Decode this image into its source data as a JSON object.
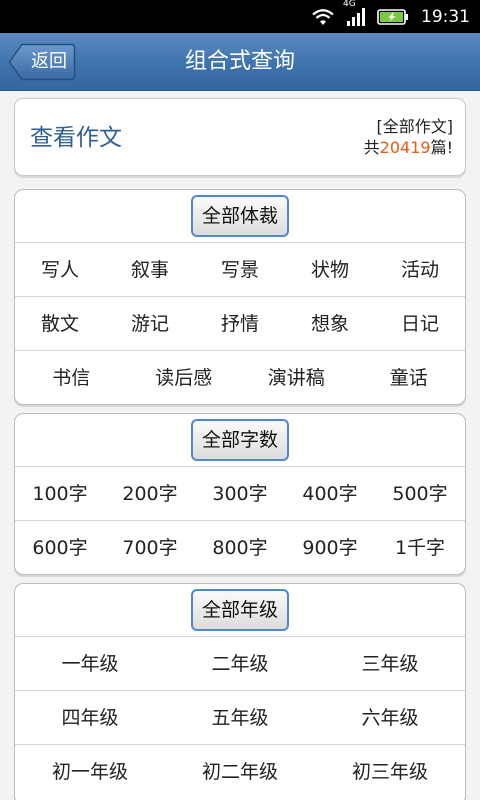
{
  "status_bar": {
    "network": "4G",
    "time": "19:31",
    "icons": [
      "wifi-icon",
      "signal-icon",
      "battery-charging-icon"
    ]
  },
  "header": {
    "back_label": "返回",
    "title": "组合式查询"
  },
  "view_card": {
    "title": "查看作文",
    "filter_label": "[全部作文]",
    "count_prefix": "共",
    "count": "20419",
    "count_suffix": "篇!"
  },
  "genre": {
    "header": "全部体裁",
    "rows": [
      [
        "写人",
        "叙事",
        "写景",
        "状物",
        "活动"
      ],
      [
        "散文",
        "游记",
        "抒情",
        "想象",
        "日记"
      ],
      [
        "书信",
        "读后感",
        "演讲稿",
        "童话"
      ]
    ]
  },
  "wordcount": {
    "header": "全部字数",
    "rows": [
      [
        "100字",
        "200字",
        "300字",
        "400字",
        "500字"
      ],
      [
        "600字",
        "700字",
        "800字",
        "900字",
        "1千字"
      ]
    ]
  },
  "grade": {
    "header": "全部年级",
    "rows": [
      [
        "一年级",
        "二年级",
        "三年级"
      ],
      [
        "四年级",
        "五年级",
        "六年级"
      ],
      [
        "初一年级",
        "初二年级",
        "初三年级"
      ]
    ]
  },
  "colors": {
    "title_bar": "#3f73ad",
    "accent_blue": "#4f86d6",
    "count_orange": "#e85a10",
    "view_title": "#2f5f94"
  }
}
